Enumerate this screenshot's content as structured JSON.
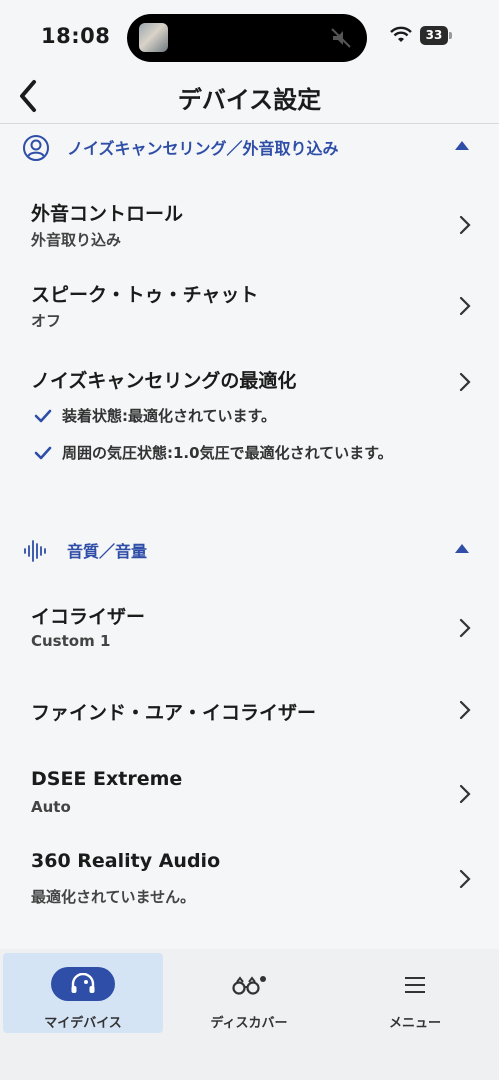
{
  "status_bar": {
    "time": "18:08",
    "battery": "33"
  },
  "header": {
    "title": "デバイス設定"
  },
  "sections": [
    {
      "title": "ノイズキャンセリング／外音取り込み",
      "icon": "person-circle-icon",
      "expanded": true,
      "rows": [
        {
          "title": "外音コントロール",
          "subtitle": "外音取り込み"
        },
        {
          "title": "スピーク・トゥ・チャット",
          "subtitle": "オフ"
        },
        {
          "title": "ノイズキャンセリングの最適化",
          "checks": [
            "装着状態:最適化されています。",
            "周囲の気圧状態:1.0気圧で最適化されています。"
          ]
        }
      ]
    },
    {
      "title": "音質／音量",
      "icon": "sound-wave-icon",
      "expanded": true,
      "rows": [
        {
          "title": "イコライザー",
          "subtitle": "Custom 1"
        },
        {
          "title": "ファインド・ユア・イコライザー"
        },
        {
          "title": "DSEE Extreme",
          "subtitle": "Auto"
        },
        {
          "title": "360 Reality Audio",
          "subtitle": "最適化されていません。"
        }
      ]
    }
  ],
  "tabbar": {
    "tabs": [
      {
        "label": "マイデバイス",
        "icon": "headphones-icon",
        "active": true
      },
      {
        "label": "ディスカバー",
        "icon": "binoculars-icon",
        "active": false
      },
      {
        "label": "メニュー",
        "icon": "hamburger-menu-icon",
        "active": false
      }
    ]
  },
  "colors": {
    "accent": "#2f4ea8",
    "background": "#f5f6f7",
    "active_tab": "#d4e4f5"
  }
}
